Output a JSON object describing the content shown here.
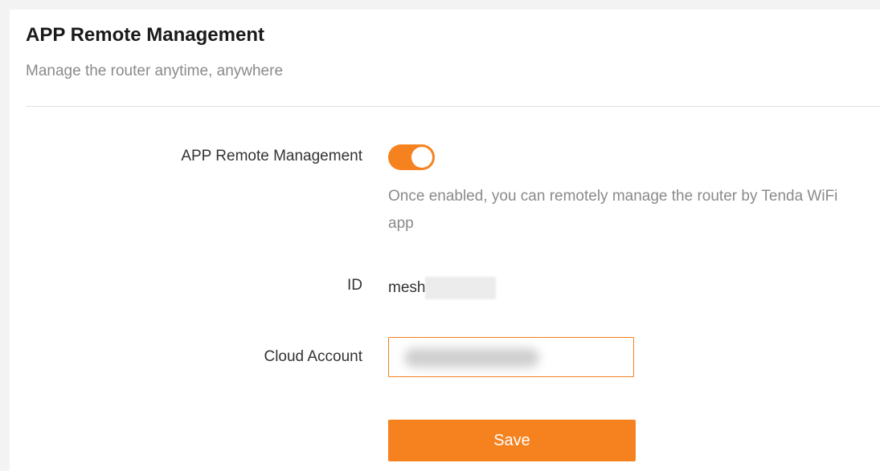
{
  "header": {
    "title": "APP Remote Management",
    "subtitle": "Manage the router anytime, anywhere"
  },
  "form": {
    "remote_management": {
      "label": "APP Remote Management",
      "enabled": true,
      "hint": "Once enabled, you can remotely manage the router by Tenda WiFi app"
    },
    "id": {
      "label": "ID",
      "value_visible": "mesh"
    },
    "cloud_account": {
      "label": "Cloud Account",
      "value": ""
    },
    "save_label": "Save"
  },
  "colors": {
    "accent": "#f5821f",
    "title": "#1a1a1a",
    "muted": "#8a8a8a",
    "label": "#333333"
  }
}
